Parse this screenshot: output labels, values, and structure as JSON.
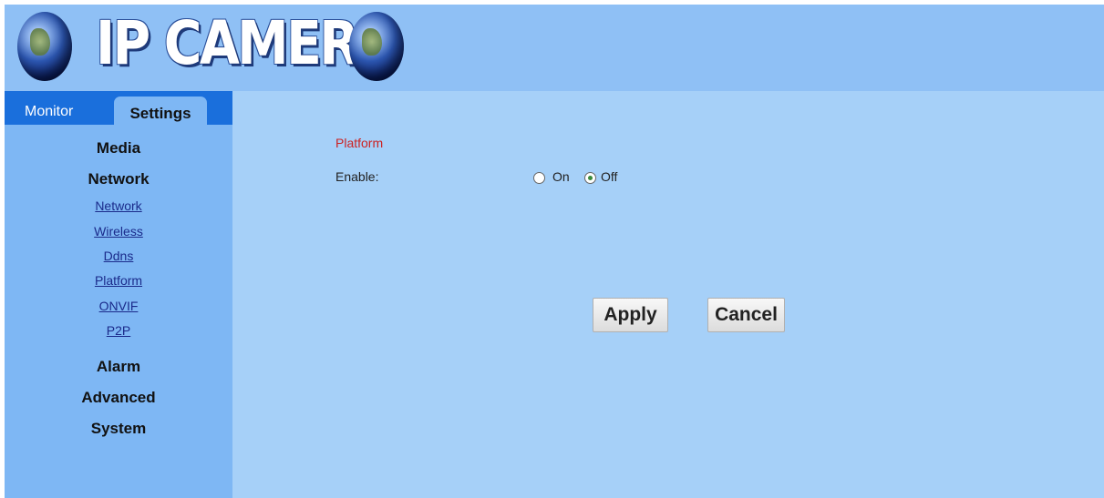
{
  "header": {
    "logo_text": "IP CAMERA",
    "left_icon": "globe-icon",
    "right_icon": "globe-icon"
  },
  "tabs": [
    {
      "label": "Monitor",
      "active": false
    },
    {
      "label": "Settings",
      "active": true
    }
  ],
  "sidebar": {
    "sections": {
      "media": "Media",
      "network": "Network",
      "alarm": "Alarm",
      "advanced": "Advanced",
      "system": "System"
    },
    "network_links": [
      "Network",
      "Wireless",
      "Ddns",
      "Platform",
      "ONVIF",
      "P2P"
    ]
  },
  "content": {
    "heading": "Platform",
    "enable_label": "Enable:",
    "enable_options": [
      {
        "label": "On",
        "selected": false
      },
      {
        "label": "Off",
        "selected": true
      }
    ]
  },
  "buttons": {
    "apply": "Apply",
    "cancel": "Cancel"
  },
  "colors": {
    "header_bg": "#8fc0f5",
    "sidebar_bg": "#7eb7f4",
    "tab_strip": "#1a6fdc",
    "content_bg": "#a6d0f8",
    "heading_red": "#cc2222",
    "link_blue": "#1a2a8a"
  }
}
